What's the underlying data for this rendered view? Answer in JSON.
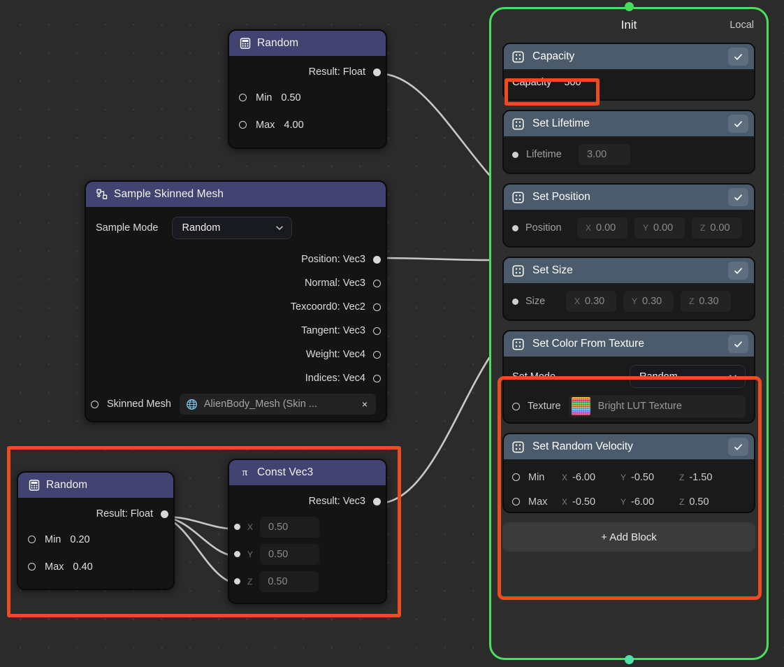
{
  "colors": {
    "canvas_bg": "#2b2b2b",
    "node_header": "#434372",
    "node_body": "#141414",
    "block_header": "#4b5b6b",
    "panel_border_top": "#45dd57",
    "panel_border_bottom": "#4ee2a8",
    "highlight": "#ef4b23",
    "wire": "#c8c8c8"
  },
  "nodes": {
    "random_top": {
      "title": "Random",
      "icon": "calculator-icon",
      "output": {
        "label": "Result: Float"
      },
      "inputs": [
        {
          "label": "Min",
          "value": "0.50"
        },
        {
          "label": "Max",
          "value": "4.00"
        }
      ]
    },
    "sample_skinned_mesh": {
      "title": "Sample Skinned Mesh",
      "icon": "mesh-sample-icon",
      "mode_label": "Sample Mode",
      "mode_value": "Random",
      "outputs": [
        {
          "label": "Position: Vec3",
          "connected": true
        },
        {
          "label": "Normal: Vec3",
          "connected": false
        },
        {
          "label": "Texcoord0: Vec2",
          "connected": false
        },
        {
          "label": "Tangent: Vec3",
          "connected": false
        },
        {
          "label": "Weight: Vec4",
          "connected": false
        },
        {
          "label": "Indices: Vec4",
          "connected": false
        }
      ],
      "asset_input": {
        "label": "Skinned Mesh",
        "asset_name": "AlienBody_Mesh (Skin ...",
        "asset_icon": "globe-icon",
        "clear_label": "×"
      }
    },
    "random_bottom": {
      "title": "Random",
      "icon": "calculator-icon",
      "output": {
        "label": "Result: Float"
      },
      "inputs": [
        {
          "label": "Min",
          "value": "0.20"
        },
        {
          "label": "Max",
          "value": "0.40"
        }
      ]
    },
    "const_vec3": {
      "title": "Const Vec3",
      "icon": "pi-icon",
      "output": {
        "label": "Result: Vec3"
      },
      "inputs": [
        {
          "axis": "X",
          "value": "0.50"
        },
        {
          "axis": "Y",
          "value": "0.50"
        },
        {
          "axis": "Z",
          "value": "0.50"
        }
      ]
    }
  },
  "init_panel": {
    "title": "Init",
    "space": "Local",
    "add_block_label": "+ Add Block",
    "blocks": [
      {
        "title": "Capacity",
        "icon": "block-icon",
        "enabled_icon": "check-icon",
        "rows": [
          {
            "kind": "capacity",
            "label": "Capacity",
            "value": "500"
          }
        ]
      },
      {
        "title": "Set Lifetime",
        "icon": "block-icon",
        "enabled_icon": "check-icon",
        "rows": [
          {
            "kind": "scalar",
            "label": "Lifetime",
            "value": "3.00"
          }
        ]
      },
      {
        "title": "Set Position",
        "icon": "block-icon",
        "enabled_icon": "check-icon",
        "rows": [
          {
            "kind": "vec3",
            "label": "Position",
            "x": "0.00",
            "y": "0.00",
            "z": "0.00"
          }
        ]
      },
      {
        "title": "Set Size",
        "icon": "block-icon",
        "enabled_icon": "check-icon",
        "rows": [
          {
            "kind": "vec3",
            "label": "Size",
            "x": "0.30",
            "y": "0.30",
            "z": "0.30"
          }
        ]
      },
      {
        "title": "Set Color From Texture",
        "icon": "block-icon",
        "enabled_icon": "check-icon",
        "mode_label": "Set Mode",
        "mode_value": "Random",
        "texture_label": "Texture",
        "texture_value": "Bright LUT Texture",
        "texture_icon": "lut-swatch-icon"
      },
      {
        "title": "Set Random Velocity",
        "icon": "block-icon",
        "enabled_icon": "check-icon",
        "rows": [
          {
            "kind": "vec3port",
            "label": "Min",
            "x": "-6.00",
            "y": "-0.50",
            "z": "-1.50"
          },
          {
            "kind": "vec3port",
            "label": "Max",
            "x": "-0.50",
            "y": "-6.00",
            "z": "0.50"
          }
        ]
      }
    ]
  },
  "axes": {
    "x": "X",
    "y": "Y",
    "z": "Z"
  }
}
